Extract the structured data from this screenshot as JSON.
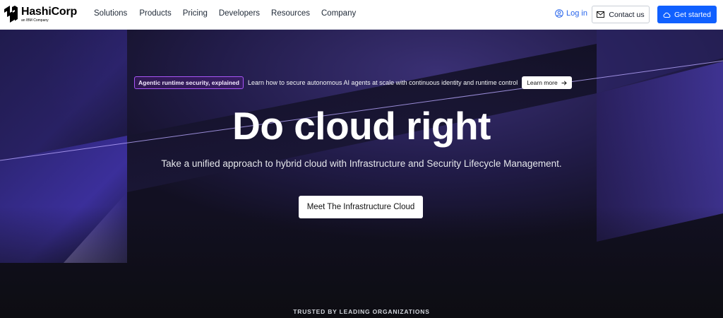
{
  "brand": {
    "name": "HashiCorp",
    "sub": "an IBM Company"
  },
  "nav": {
    "items": [
      "Solutions",
      "Products",
      "Pricing",
      "Developers",
      "Resources",
      "Company"
    ],
    "login": "Log in",
    "contact": "Contact us",
    "get_started": "Get started"
  },
  "announcement": {
    "tag": "Agentic runtime security, explained",
    "text": "Learn how to secure autonomous AI agents at scale with continuous identity and runtime control",
    "link": "Learn more"
  },
  "hero": {
    "title": "Do cloud right",
    "subtitle": "Take a unified approach to hybrid cloud with Infrastructure and Security Lifecycle Management.",
    "cta": "Meet The Infrastructure Cloud"
  },
  "trusted_label": "TRUSTED BY LEADING ORGANIZATIONS",
  "colors": {
    "primary": "#1060ff",
    "tag_border": "#a855f7",
    "link": "#2563eb"
  }
}
